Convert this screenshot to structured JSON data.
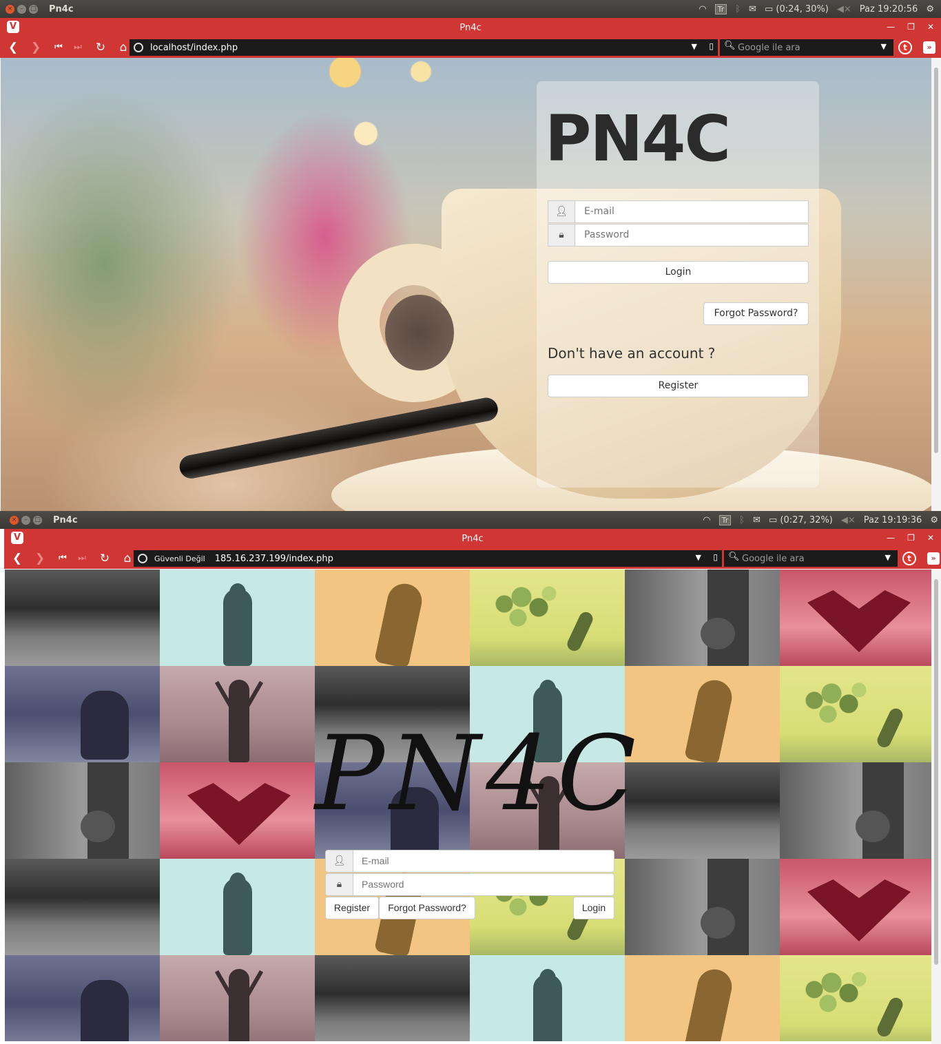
{
  "shot1": {
    "os_bar": {
      "app_title": "Pn4c",
      "keyboard_indicator": "Tr",
      "battery": "(0:24, 30%)",
      "clock": "Paz 19:20:56"
    },
    "browser": {
      "window_title": "Pn4c",
      "url": "localhost/index.php",
      "search_placeholder": "Google ile ara"
    },
    "page": {
      "logo": "PN4C",
      "email_placeholder": "E-mail",
      "password_placeholder": "Password",
      "login_label": "Login",
      "forgot_label": "Forgot Password?",
      "no_account_text": "Don't have an account ?",
      "register_label": "Register"
    }
  },
  "shot2": {
    "os_bar": {
      "app_title": "Pn4c",
      "keyboard_indicator": "Tr",
      "battery": "(0:27, 32%)",
      "clock": "Paz 19:19:36"
    },
    "browser": {
      "window_title": "Pn4c",
      "security_label": "Güvenli Değil",
      "url": "185.16.237.199/index.php",
      "search_placeholder": "Google ile ara"
    },
    "page": {
      "logo": "PN4C",
      "email_placeholder": "E-mail",
      "password_placeholder": "Password",
      "register_label": "Register",
      "forgot_label": "Forgot Password?",
      "login_label": "Login",
      "tiles": [
        "rain",
        "woman",
        "jump",
        "balloon",
        "bridge",
        "heart",
        "kneel",
        "arms",
        "rain",
        "woman",
        "jump",
        "balloon",
        "bridge",
        "heart",
        "kneel",
        "arms",
        "rain",
        "bridge",
        "rain",
        "woman",
        "jump",
        "balloon",
        "bridge",
        "heart",
        "kneel",
        "arms",
        "rain",
        "woman",
        "jump",
        "balloon"
      ]
    }
  },
  "colors": {
    "vivaldi_red": "#cf3634",
    "os_panel": "#3f3e3a",
    "url_field": "#1c1b1b"
  }
}
